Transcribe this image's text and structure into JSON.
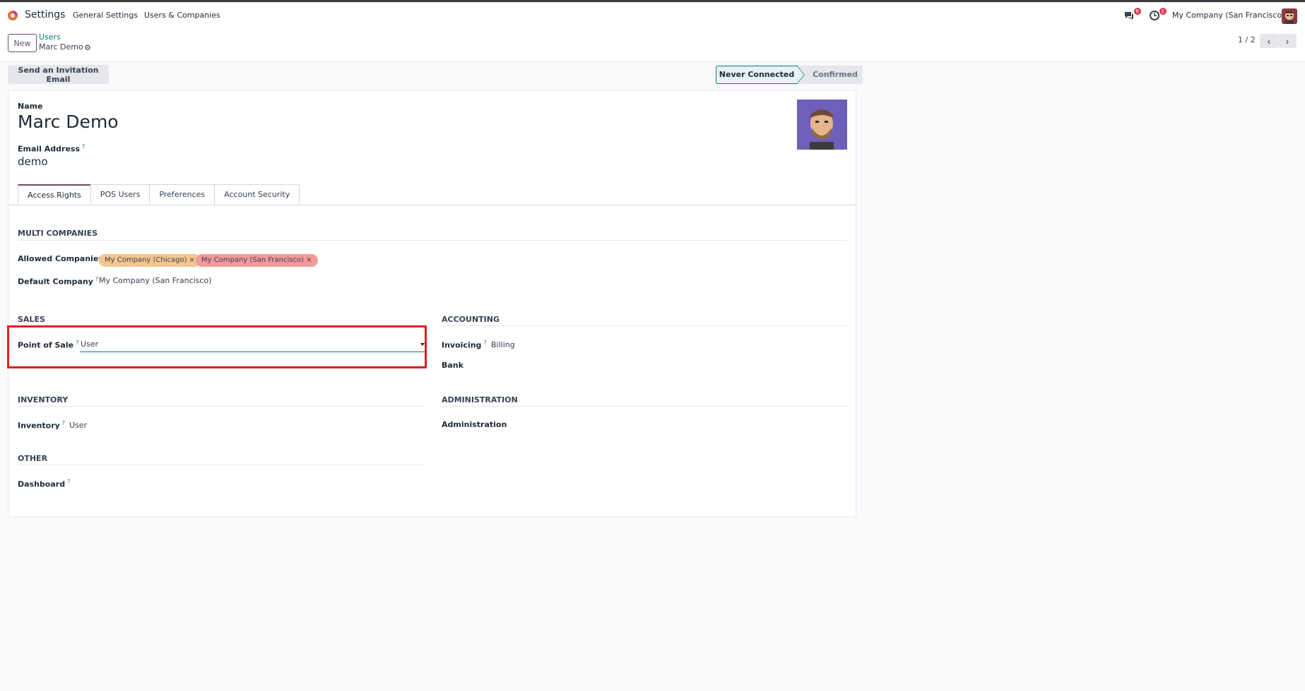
{
  "navbar": {
    "app_name": "Settings",
    "menu": [
      "General Settings",
      "Users & Companies"
    ],
    "messages_badge": "6",
    "activities_badge": "1",
    "company": "My Company (San Francisco)"
  },
  "control_panel": {
    "new_label": "New",
    "breadcrumb_parent": "Users",
    "breadcrumb_current": "Marc Demo",
    "pager": "1 / 2"
  },
  "statusbar": {
    "invite_label": "Send an Invitation Email",
    "states": [
      "Never Connected",
      "Confirmed"
    ],
    "active_state": "Never Connected"
  },
  "form": {
    "name_label": "Name",
    "name_value": "Marc Demo",
    "email_label": "Email Address",
    "email_value": "demo",
    "help_mark": "?"
  },
  "tabs": [
    "Access Rights",
    "POS Users",
    "Preferences",
    "Account Security"
  ],
  "access_rights": {
    "multi_companies": {
      "title": "MULTI COMPANIES",
      "allowed_label": "Allowed Companies",
      "allowed_tags": [
        "My Company (Chicago)",
        "My Company (San Francisco)"
      ],
      "tag_remove": "×",
      "default_label": "Default Company",
      "default_value": "My Company (San Francisco)"
    },
    "sales": {
      "title": "SALES",
      "pos_label": "Point of Sale",
      "pos_value": "User"
    },
    "accounting": {
      "title": "ACCOUNTING",
      "invoicing_label": "Invoicing",
      "invoicing_value": "Billing",
      "bank_label": "Bank"
    },
    "inventory": {
      "title": "INVENTORY",
      "inventory_label": "Inventory",
      "inventory_value": "User"
    },
    "administration": {
      "title": "ADMINISTRATION",
      "administration_label": "Administration"
    },
    "other": {
      "title": "OTHER",
      "dashboard_label": "Dashboard"
    }
  },
  "colors": {
    "brand": "#714b67",
    "accent": "#017e84",
    "highlight": "#e02020"
  }
}
